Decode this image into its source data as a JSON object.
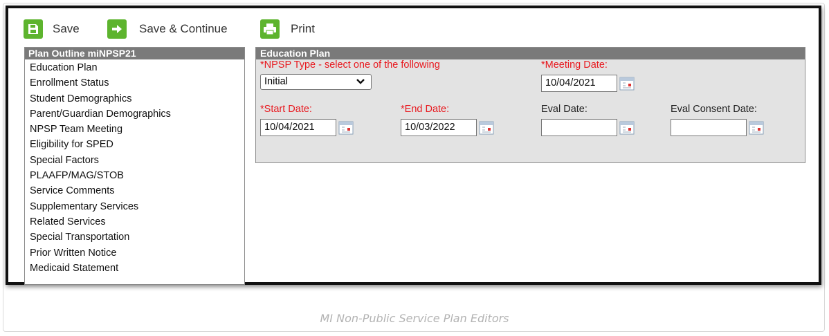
{
  "toolbar": {
    "save_label": "Save",
    "save_continue_label": "Save & Continue",
    "print_label": "Print"
  },
  "outline": {
    "header": "Plan Outline miNPSP21",
    "items": [
      "Education Plan",
      "Enrollment Status",
      "Student Demographics",
      "Parent/Guardian Demographics",
      "NPSP Team Meeting",
      "Eligibility for SPED",
      "Special Factors",
      "PLAAFP/MAG/STOB",
      "Service Comments",
      "Supplementary Services",
      "Related Services",
      "Special Transportation",
      "Prior Written Notice",
      "Medicaid Statement"
    ]
  },
  "plan": {
    "header": "Education Plan",
    "npsp_type_label": "*NPSP Type - select one of the following",
    "npsp_type_value": "Initial",
    "meeting_date_label": "*Meeting Date:",
    "meeting_date_value": "10/04/2021",
    "start_date_label": "*Start Date:",
    "start_date_value": "10/04/2021",
    "end_date_label": "*End Date:",
    "end_date_value": "10/03/2022",
    "eval_date_label": "Eval Date:",
    "eval_date_value": "",
    "eval_consent_label": "Eval Consent Date:",
    "eval_consent_value": ""
  },
  "caption": "MI Non-Public Service Plan Editors",
  "colors": {
    "toolbar_icon": "#5db42e",
    "header_bar": "#7a7a7a",
    "required_label": "#e8191f",
    "panel_bg": "#e3e3e3"
  },
  "icons": [
    "save-icon",
    "arrow-right-icon",
    "printer-icon",
    "calendar-icon",
    "chevron-down-icon"
  ]
}
